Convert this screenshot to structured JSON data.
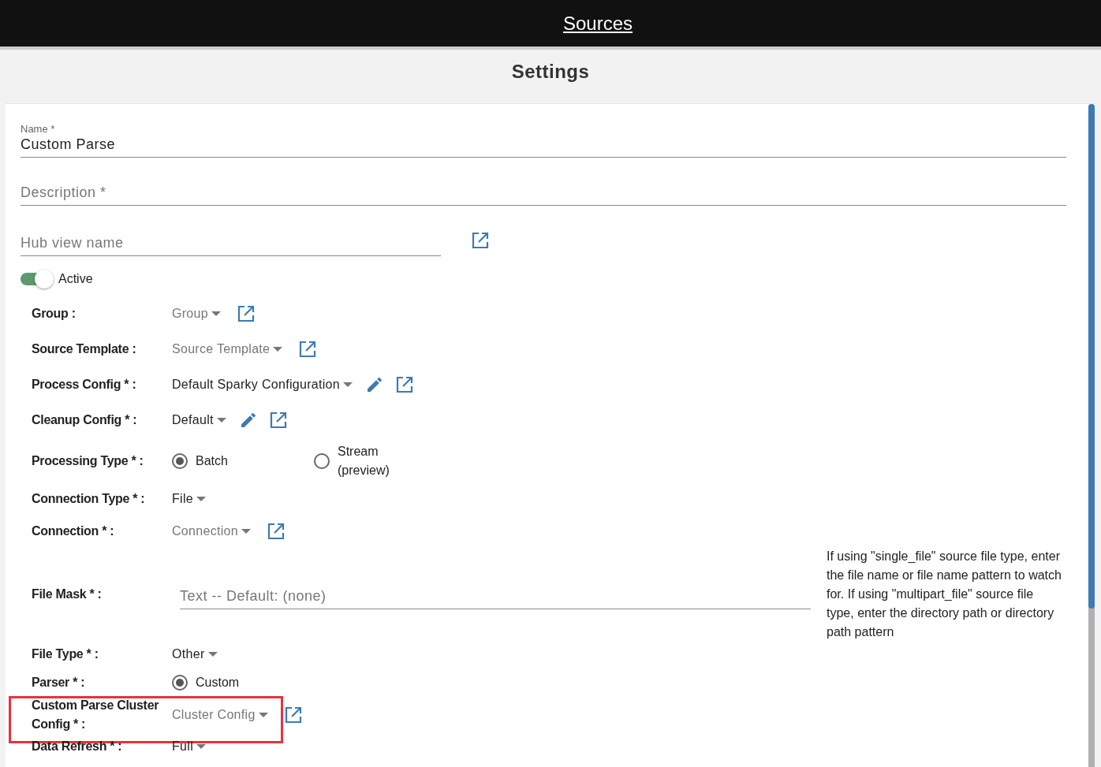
{
  "header": {
    "title": "Sources"
  },
  "page_title": "Settings",
  "name_field": {
    "label": "Name *",
    "value": "Custom Parse"
  },
  "description_field": {
    "placeholder": "Description *"
  },
  "hub_view_field": {
    "placeholder": "Hub view name",
    "open_icon": true
  },
  "active_toggle": {
    "label": "Active",
    "on": true
  },
  "rows": [
    {
      "kind": "select",
      "label": "Group :",
      "placeholder": "Group",
      "open_icon": true
    },
    {
      "kind": "select",
      "label": "Source Template :",
      "placeholder": "Source Template",
      "open_icon": true
    },
    {
      "kind": "select",
      "label": "Process Config * :",
      "value": "Default Sparky Configuration",
      "edit_icon": true,
      "open_icon": true
    },
    {
      "kind": "select",
      "label": "Cleanup Config * :",
      "value": "Default",
      "edit_icon": true,
      "open_icon": true
    },
    {
      "kind": "radio",
      "label": "Processing Type * :",
      "options": [
        {
          "label": "Batch",
          "selected": true
        },
        {
          "label": "Stream\n(preview)",
          "selected": false
        }
      ]
    },
    {
      "kind": "select",
      "label": "Connection Type * :",
      "value": "File"
    },
    {
      "kind": "select",
      "label": "Connection * :",
      "placeholder": "Connection",
      "open_icon": true
    },
    {
      "kind": "text",
      "label": "File Mask * :",
      "placeholder": "Text -- Default: (none)",
      "help": "If using \"single_file\" source file type, enter the file name or file name pattern to watch for. If using \"multipart_file\" source file type, enter the directory path or directory path pattern"
    },
    {
      "kind": "select",
      "label": "File Type * :",
      "value": "Other"
    },
    {
      "kind": "radio",
      "label": "Parser * :",
      "options": [
        {
          "label": "Custom",
          "selected": true
        }
      ]
    },
    {
      "kind": "select",
      "label": "Custom Parse Cluster Config * :",
      "placeholder": "Cluster Config",
      "open_icon": true,
      "highlighted": true
    },
    {
      "kind": "select",
      "label": "Data Refresh * :",
      "value": "Full"
    }
  ]
}
